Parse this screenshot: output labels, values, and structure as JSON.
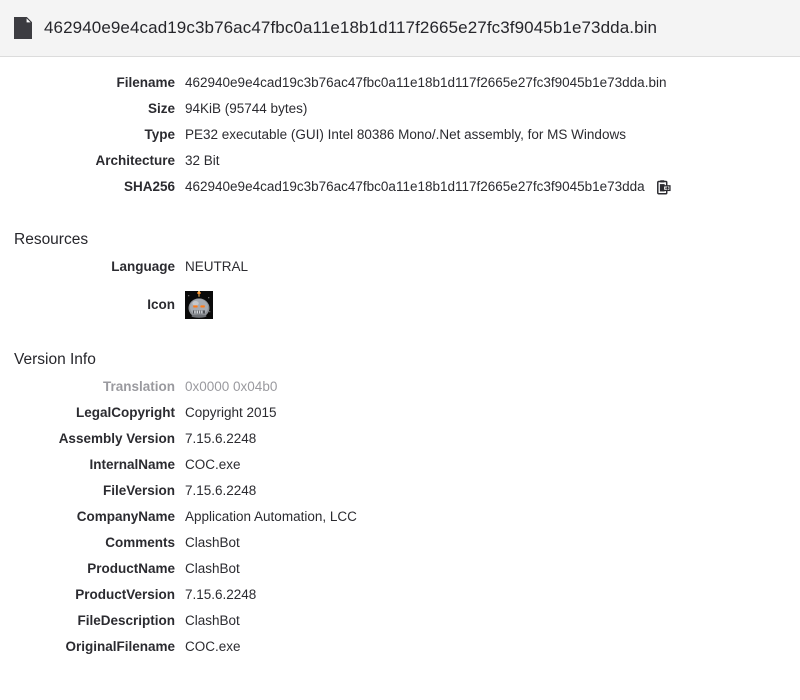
{
  "header": {
    "icon": "file-document-icon",
    "title": "462940e9e4cad19c3b76ac47fbc0a11e18b1d117f2665e27fc3f9045b1e73dda.bin"
  },
  "file_info": {
    "rows": [
      {
        "label": "Filename",
        "value": "462940e9e4cad19c3b76ac47fbc0a11e18b1d117f2665e27fc3f9045b1e73dda.bin"
      },
      {
        "label": "Size",
        "value": "94KiB (95744 bytes)"
      },
      {
        "label": "Type",
        "value": "PE32 executable (GUI) Intel 80386 Mono/.Net assembly, for MS Windows"
      },
      {
        "label": "Architecture",
        "value": "32 Bit"
      },
      {
        "label": "SHA256",
        "value": "462940e9e4cad19c3b76ac47fbc0a11e18b1d117f2665e27fc3f9045b1e73dda"
      }
    ],
    "copy_icon": "clipboard-copy-icon"
  },
  "resources": {
    "title": "Resources",
    "language_label": "Language",
    "language_value": "NEUTRAL",
    "icon_label": "Icon",
    "icon_name": "embedded-bomb-resource-icon"
  },
  "version_info": {
    "title": "Version Info",
    "rows": [
      {
        "label": "Translation",
        "value": "0x0000 0x04b0",
        "muted": true
      },
      {
        "label": "LegalCopyright",
        "value": "Copyright 2015",
        "muted": false
      },
      {
        "label": "Assembly Version",
        "value": "7.15.6.2248",
        "muted": false
      },
      {
        "label": "InternalName",
        "value": "COC.exe",
        "muted": false
      },
      {
        "label": "FileVersion",
        "value": "7.15.6.2248",
        "muted": false
      },
      {
        "label": "CompanyName",
        "value": "Application Automation, LCC",
        "muted": false
      },
      {
        "label": "Comments",
        "value": "ClashBot",
        "muted": false
      },
      {
        "label": "ProductName",
        "value": "ClashBot",
        "muted": false
      },
      {
        "label": "ProductVersion",
        "value": "7.15.6.2248",
        "muted": false
      },
      {
        "label": "FileDescription",
        "value": "ClashBot",
        "muted": false
      },
      {
        "label": "OriginalFilename",
        "value": "COC.exe",
        "muted": false
      }
    ]
  },
  "colors": {
    "header_background": "#f4f4f4",
    "header_border": "#dcdcdc",
    "text": "#2b2b30",
    "muted_text": "#9a9a9f",
    "page_background": "#ffffff"
  }
}
